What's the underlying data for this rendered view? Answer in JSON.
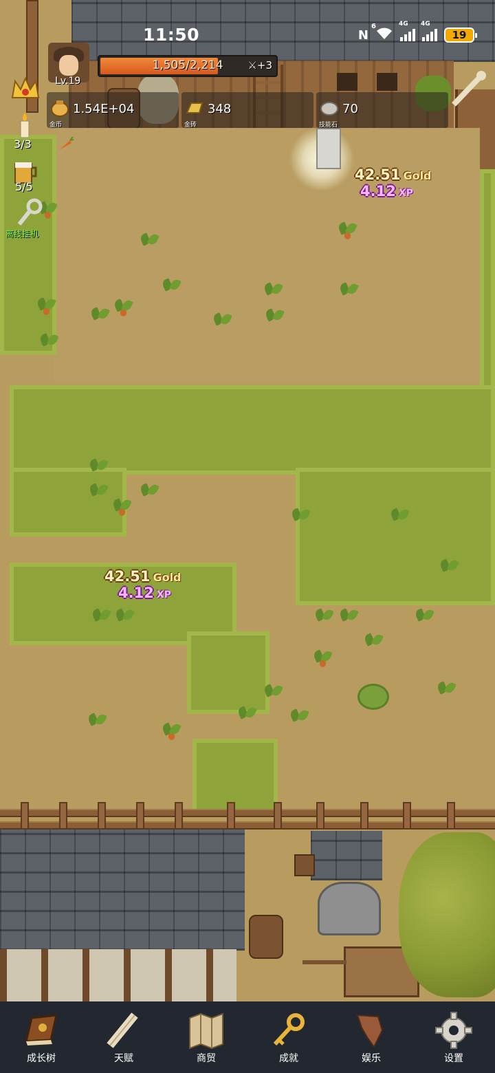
{
  "status_bar": {
    "time": "11:50",
    "nfc": "N",
    "wifi_badge": "6",
    "signal1": "4G",
    "signal2": "4G",
    "battery": "19"
  },
  "player": {
    "level": "Lv.19",
    "xp_text": "1,505/2,214",
    "xp_fraction": 0.68,
    "xp_bonus": "+3"
  },
  "resources": {
    "gold": {
      "value": "1.54E+04",
      "label": "金币",
      "icon": "gold-coin-bag-icon"
    },
    "gold_bar": {
      "value": "348",
      "label": "金砖",
      "icon": "gold-bar-icon"
    },
    "skill_stone": {
      "value": "70",
      "label": "技能石",
      "icon": "skill-stone-icon"
    }
  },
  "side": {
    "candle_count": "3/3",
    "beer_count": "5/5",
    "idle_label": "离线挂机"
  },
  "rewards": [
    {
      "gold": "42.51",
      "gold_unit": "Gold",
      "xp": "4.12",
      "xp_unit": "XP"
    },
    {
      "gold": "42.51",
      "gold_unit": "Gold",
      "xp": "4.12",
      "xp_unit": "XP"
    }
  ],
  "nav": [
    {
      "label": "成长树",
      "icon": "book-icon"
    },
    {
      "label": "天赋",
      "icon": "scroll-icon"
    },
    {
      "label": "商贸",
      "icon": "map-icon"
    },
    {
      "label": "成就",
      "icon": "key-icon"
    },
    {
      "label": "娱乐",
      "icon": "banner-icon"
    },
    {
      "label": "设置",
      "icon": "gear-icon"
    }
  ],
  "colors": {
    "nav_bg": "#23272f",
    "xp_fill": "#e06a28",
    "dirt": "#b99d62",
    "grass": "#8ea33a"
  }
}
